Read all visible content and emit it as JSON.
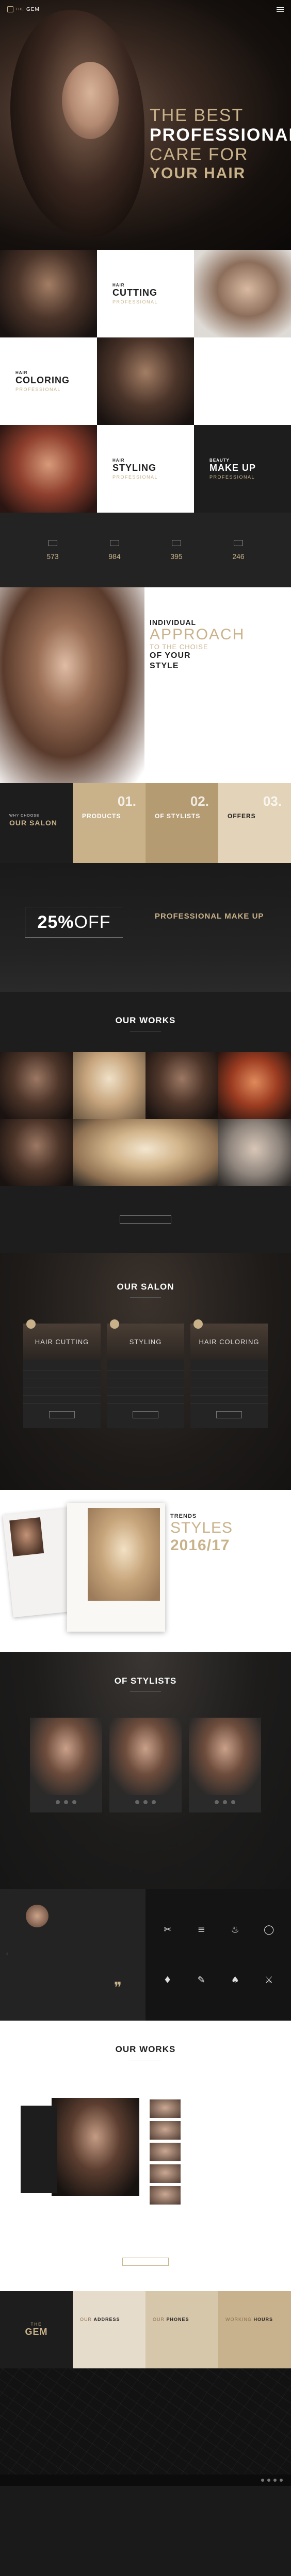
{
  "nav": {
    "logo_prefix": "THE",
    "logo_name": "GEM"
  },
  "hero": {
    "line1": "THE BEST",
    "line2": "PROFESSIONAL",
    "line3": "CARE FOR",
    "line4": "YOUR HAIR"
  },
  "services": [
    {
      "small": "HAIR",
      "big": "CUTTING",
      "sub": "PROFESSIONAL"
    },
    {
      "small": "HAIR",
      "big": "COLORING",
      "sub": "PROFESSIONAL"
    },
    {
      "small": "HAIR",
      "big": "STYLING",
      "sub": "PROFESSIONAL"
    },
    {
      "small": "BEAUTY",
      "big": "MAKE UP",
      "sub": "PROFESSIONAL"
    }
  ],
  "stats": [
    {
      "value": "573"
    },
    {
      "value": "984"
    },
    {
      "value": "395"
    },
    {
      "value": "246"
    }
  ],
  "approach": {
    "t1": "INDIVIDUAL",
    "t2": "APPROACH",
    "t3": "TO THE CHOISE",
    "t4a": "OF YOUR",
    "t4b": "STYLE"
  },
  "features": {
    "intro_small": "WHY CHOOSE",
    "intro_big": "OUR SALON",
    "items": [
      {
        "num": "01.",
        "title": "PRODUCTS"
      },
      {
        "num": "02.",
        "title": "OF STYLISTS"
      },
      {
        "num": "03.",
        "title": "OFFERS"
      }
    ]
  },
  "promo": {
    "pct": "25%",
    "off": "OFF",
    "title": "PROFESSIONAL MAKE UP"
  },
  "works": {
    "title": "OUR WORKS"
  },
  "salon": {
    "title": "OUR SALON",
    "cards": [
      {
        "title": "HAIR CUTTING"
      },
      {
        "title": "STYLING"
      },
      {
        "title": "HAIR COLORING"
      }
    ]
  },
  "trends": {
    "small": "TRENDS",
    "big": "STYLES",
    "year": "2016/17"
  },
  "stylists": {
    "title": "OF STYLISTS"
  },
  "works2": {
    "title": "OUR WORKS"
  },
  "contact": {
    "logo_prefix": "THE",
    "logo_name": "GEM",
    "cols": [
      {
        "a": "OUR",
        "b": "ADDRESS"
      },
      {
        "a": "OUR",
        "b": "PHONES"
      },
      {
        "a": "WORKING",
        "b": "HOURS"
      }
    ]
  },
  "colors": {
    "accent": "#c9b28a",
    "dark": "#1d1d1d"
  }
}
